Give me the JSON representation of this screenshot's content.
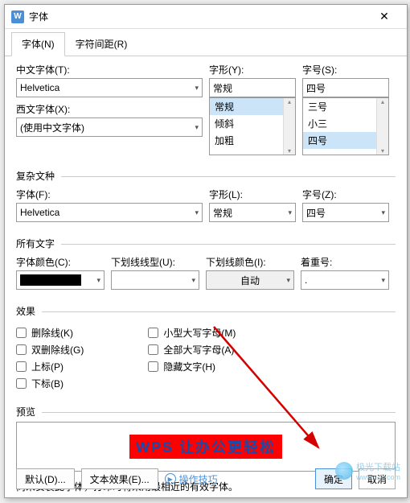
{
  "window": {
    "title": "字体",
    "icon_text": "W"
  },
  "tabs": {
    "font": "字体(N)",
    "spacing": "字符间距(R)"
  },
  "section1": {
    "chinese_font_label": "中文字体(T):",
    "chinese_font_value": "Helvetica",
    "western_font_label": "西文字体(X):",
    "western_font_value": "(使用中文字体)",
    "style_label": "字形(Y):",
    "style_value": "常规",
    "style_options": [
      "常规",
      "倾斜",
      "加粗"
    ],
    "size_label": "字号(S):",
    "size_value": "四号",
    "size_options": [
      "三号",
      "小三",
      "四号"
    ]
  },
  "section2": {
    "legend": "复杂文种",
    "font_label": "字体(F):",
    "font_value": "Helvetica",
    "style_label": "字形(L):",
    "style_value": "常规",
    "size_label": "字号(Z):",
    "size_value": "四号"
  },
  "section3": {
    "legend": "所有文字",
    "font_color_label": "字体颜色(C):",
    "underline_style_label": "下划线线型(U):",
    "underline_color_label": "下划线颜色(I):",
    "underline_color_value": "自动",
    "emphasis_label": "着重号:",
    "emphasis_value": "."
  },
  "section4": {
    "legend": "效果",
    "strikethrough": "删除线(K)",
    "double_strike": "双删除线(G)",
    "superscript": "上标(P)",
    "subscript": "下标(B)",
    "small_caps": "小型大写字母(M)",
    "all_caps": "全部大写字母(A)",
    "hidden": "隐藏文字(H)"
  },
  "preview": {
    "legend": "预览",
    "text": "WPS 让办公更轻松",
    "note": "尚未安装此字体，打印时将采用最相近的有效字体。"
  },
  "footer": {
    "default_btn": "默认(D)...",
    "text_effect_btn": "文本效果(E)...",
    "tips_link": "操作技巧",
    "ok_btn": "确定",
    "cancel_btn": "取消"
  },
  "watermark": {
    "text": "极光下载站",
    "url": "www.xz7.com"
  }
}
